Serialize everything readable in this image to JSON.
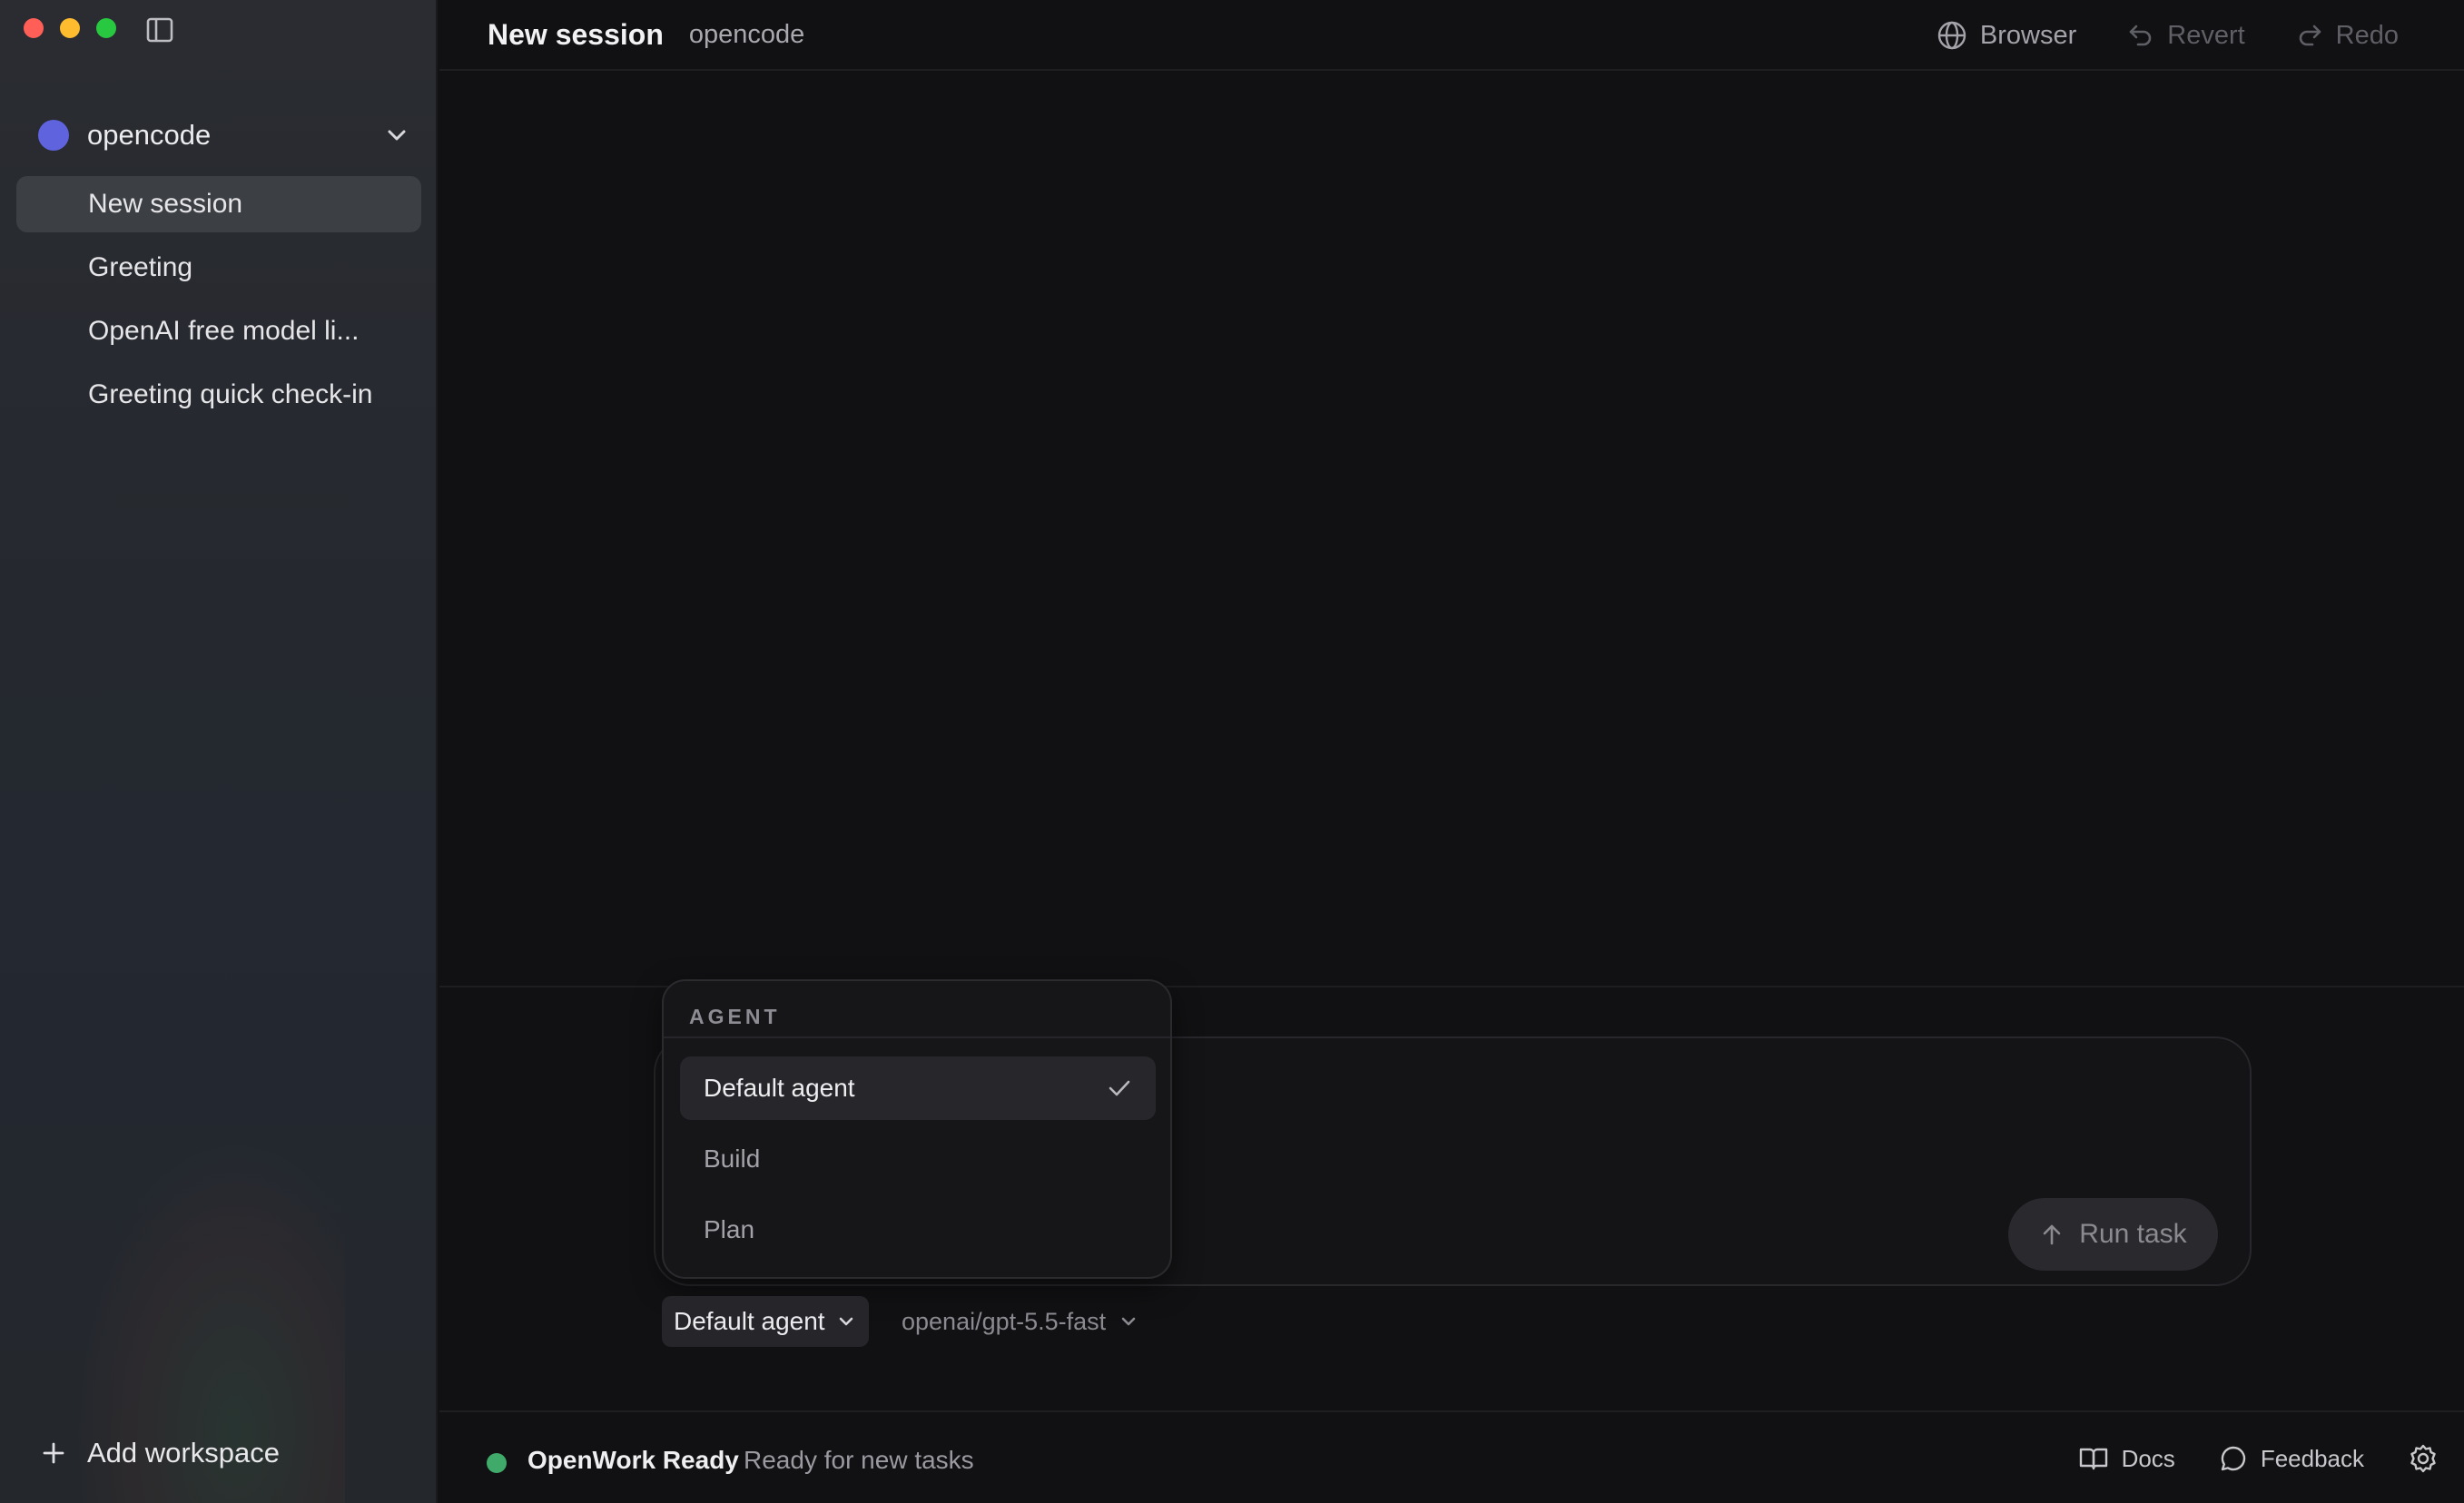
{
  "window": {
    "controls": [
      "close",
      "minimize",
      "zoom"
    ]
  },
  "sidebar": {
    "workspace": {
      "name": "opencode",
      "color": "#5f63de"
    },
    "sessions": [
      {
        "label": "New session",
        "active": true
      },
      {
        "label": "Greeting",
        "active": false
      },
      {
        "label": "OpenAI free model li...",
        "active": false
      },
      {
        "label": "Greeting quick check-in",
        "active": false
      }
    ],
    "add_workspace_label": "Add workspace"
  },
  "header": {
    "title": "New session",
    "subtitle": "opencode",
    "actions": {
      "browser": "Browser",
      "revert": "Revert",
      "redo": "Redo"
    }
  },
  "agent_dropdown": {
    "heading": "AGENT",
    "options": [
      {
        "label": "Default agent",
        "selected": true
      },
      {
        "label": "Build",
        "selected": false
      },
      {
        "label": "Plan",
        "selected": false
      }
    ]
  },
  "composer": {
    "run_label": "Run task",
    "agent_selected": "Default agent",
    "model_selected": "openai/gpt-5.5-fast"
  },
  "status_bar": {
    "title": "OpenWork Ready",
    "text": "Ready for new tasks",
    "status_color": "#3faa6a",
    "docs_label": "Docs",
    "feedback_label": "Feedback"
  }
}
